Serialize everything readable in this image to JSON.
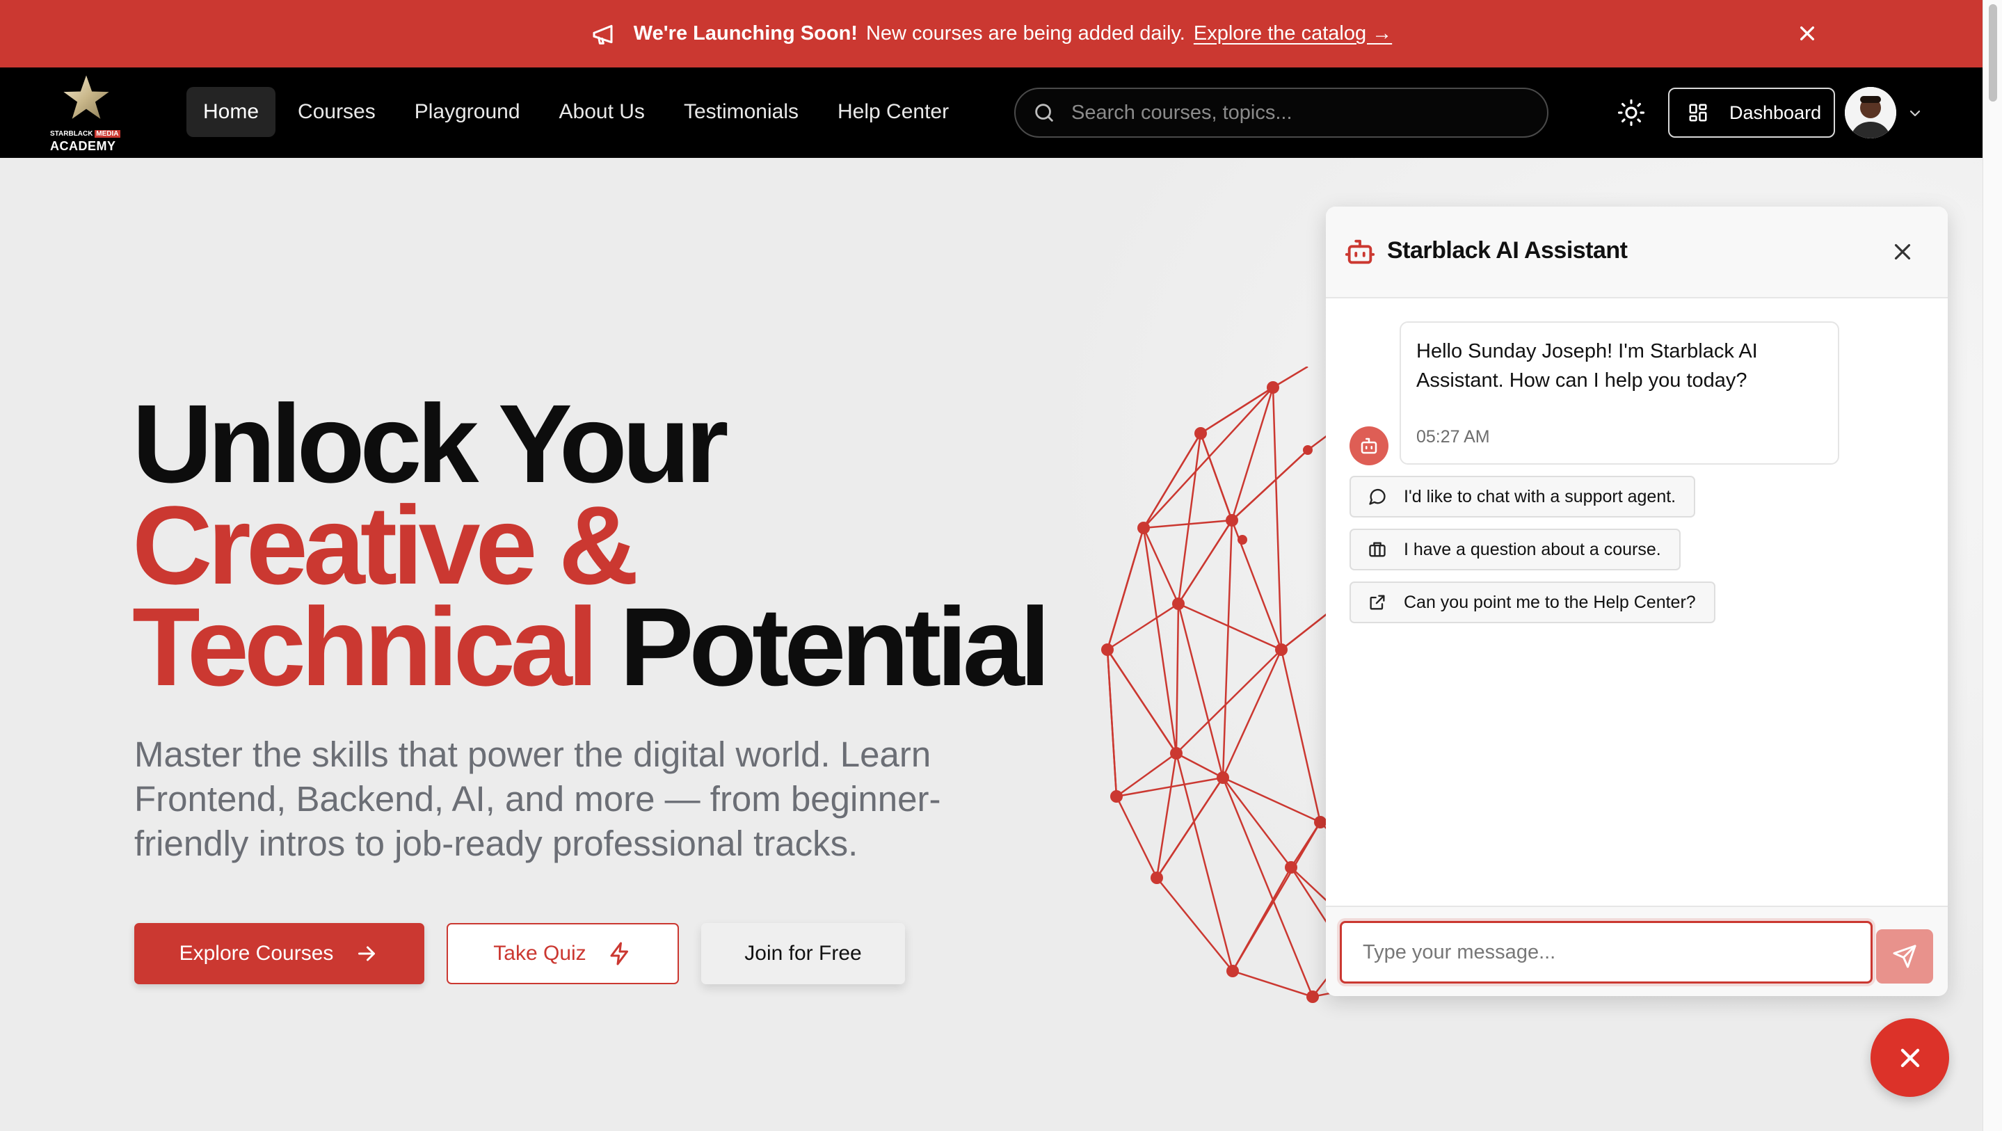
{
  "banner": {
    "title": "We're Launching Soon!",
    "message": "New courses are being added daily.",
    "link": "Explore the catalog →",
    "close": "×"
  },
  "nav": {
    "logo_top_a": "STARBLACK",
    "logo_top_b": "MEDIA",
    "logo_bottom": "ACADEMY",
    "links": [
      "Home",
      "Courses",
      "Playground",
      "About Us",
      "Testimonials",
      "Help Center"
    ],
    "active": "Home",
    "search_placeholder": "Search courses, topics...",
    "dashboard": "Dashboard"
  },
  "hero": {
    "line1": "Unlock Your",
    "line2": "Creative &",
    "line3_red": "Technical",
    "line3_dark": "Potential",
    "subtitle": "Master the skills that power the digital world. Learn Frontend, Backend, AI, and more — from beginner-friendly intros to job-ready professional tracks.",
    "btn_explore": "Explore Courses",
    "btn_quiz": "Take Quiz",
    "btn_join": "Join for Free"
  },
  "chat": {
    "title": "Starblack AI Assistant",
    "greeting": "Hello Sunday Joseph! I'm Starblack AI Assistant. How can I help you today?",
    "time": "05:27 AM",
    "suggestions": [
      "I'd like to chat with a support agent.",
      "I have a question about a course.",
      "Can you point me to the Help Center?"
    ],
    "input_placeholder": "Type your message..."
  },
  "colors": {
    "brand_red": "#cb3831",
    "nav_bg": "#000000",
    "page_bg": "#ececec"
  },
  "icons": {
    "banner": "megaphone-icon",
    "theme": "sun-icon",
    "dashboard": "layout-grid-icon",
    "chat_header": "bot-icon",
    "suggestions": [
      "message-circle-icon",
      "briefcase-icon",
      "external-link-icon"
    ],
    "send": "send-icon",
    "fab": "close-icon"
  }
}
